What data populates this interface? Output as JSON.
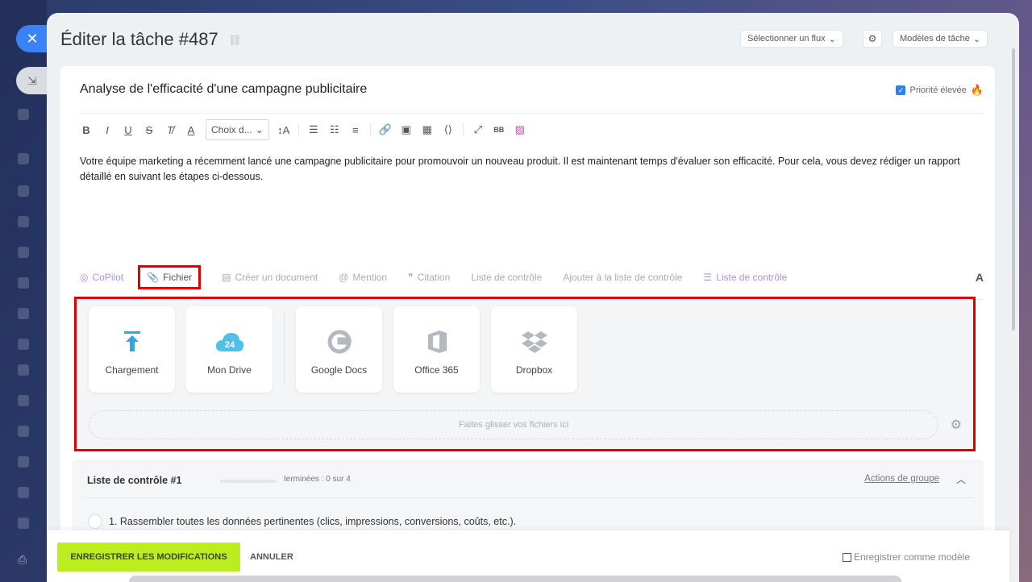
{
  "header": {
    "title": "Éditer la tâche #487",
    "flow_button": "Sélectionner un flux",
    "templates_button": "Modèles de tâche"
  },
  "task": {
    "title": "Analyse de l'efficacité d'une campagne publicitaire",
    "priority_label": "Priorité élevée",
    "priority_checked": true,
    "description": "Votre équipe marketing a récemment lancé une campagne publicitaire pour promouvoir un nouveau produit. Il est maintenant temps d'évaluer son efficacité. Pour cela, vous devez rédiger un rapport détaillé en suivant les étapes ci-dessous."
  },
  "toolbar": {
    "font_select": "Choix d..."
  },
  "action_tabs": {
    "copilot": "CoPilot",
    "file": "Fichier",
    "create_doc": "Créer un document",
    "mention": "Mention",
    "quote": "Citation",
    "checklist": "Liste de contrôle",
    "add_to_checklist": "Ajouter à la liste de contrôle",
    "checklist_active": "Liste de contrôle",
    "format": "A"
  },
  "upload": {
    "tiles": [
      {
        "label": "Chargement",
        "icon": "upload-arrow-icon"
      },
      {
        "label": "Mon Drive",
        "icon": "cloud-24-icon",
        "badge": "24"
      },
      {
        "label": "Google Docs",
        "icon": "google-icon"
      },
      {
        "label": "Office 365",
        "icon": "office-icon"
      },
      {
        "label": "Dropbox",
        "icon": "dropbox-icon"
      }
    ],
    "dropzone": "Faites glisser vos fichiers ici"
  },
  "checklist": {
    "title": "Liste de contrôle #1",
    "progress": 0,
    "count": "terminées : 0 sur 4",
    "actions": "Actions de groupe",
    "items": [
      "1. Rassembler toutes les données pertinentes (clics, impressions, conversions, coûts, etc.)."
    ]
  },
  "footer": {
    "save": "ENREGISTRER LES MODIFICATIONS",
    "cancel": "ANNULER",
    "save_template": "Enregistrer comme modèle"
  },
  "colors": {
    "accent_blue": "#3b82f6",
    "save_green": "#bbed21",
    "highlight_red": "#e00000"
  }
}
